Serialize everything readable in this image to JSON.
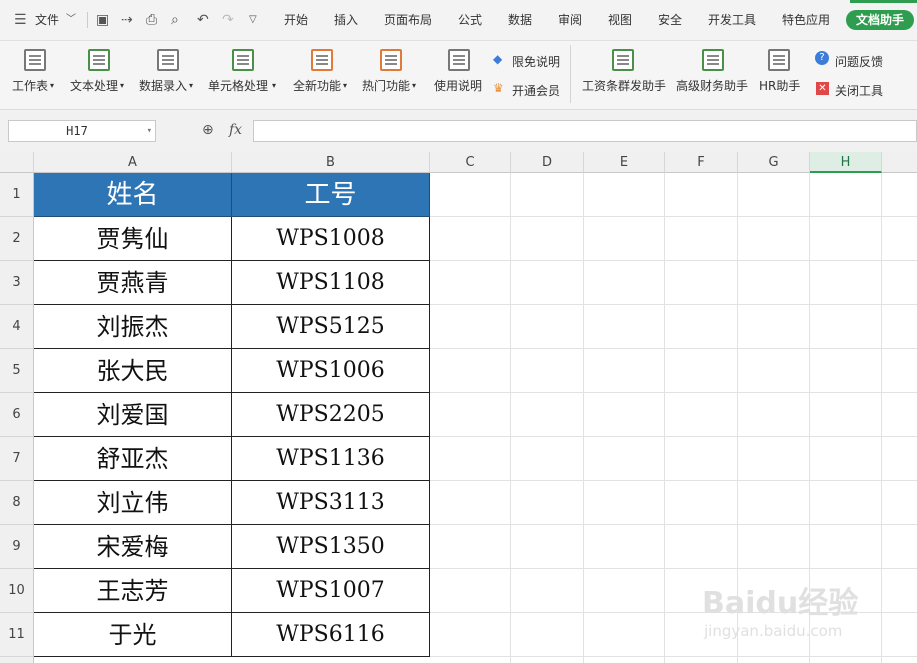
{
  "menubar": {
    "file_label": "文件",
    "tabs": [
      "开始",
      "插入",
      "页面布局",
      "公式",
      "数据",
      "审阅",
      "视图",
      "安全",
      "开发工具",
      "特色应用"
    ],
    "assistant_label": "文档助手"
  },
  "ribbon": {
    "buttons": [
      {
        "label": "工作表",
        "icon": "worksheet-icon"
      },
      {
        "label": "文本处理",
        "icon": "text-process-icon"
      },
      {
        "label": "数据录入",
        "icon": "data-entry-icon"
      },
      {
        "label": "单元格处理",
        "icon": "cell-process-icon"
      },
      {
        "label": "全新功能",
        "icon": "new-feature-icon"
      },
      {
        "label": "热门功能",
        "icon": "hot-feature-icon"
      },
      {
        "label": "使用说明",
        "icon": "manual-icon"
      }
    ],
    "small": {
      "free_label": "限免说明",
      "vip_label": "开通会员"
    },
    "helpers": [
      {
        "label": "工资条群发助手",
        "icon": "payslip-icon"
      },
      {
        "label": "高级财务助手",
        "icon": "finance-icon"
      },
      {
        "label": "HR助手",
        "icon": "hr-icon"
      }
    ],
    "feedback_label": "问题反馈",
    "close_label": "关闭工具"
  },
  "formula_bar": {
    "name_box": "H17",
    "fx_label": "fx",
    "formula": ""
  },
  "sheet": {
    "columns": [
      "A",
      "B",
      "C",
      "D",
      "E",
      "F",
      "G",
      "H"
    ],
    "active_column": "H",
    "rows": [
      "1",
      "2",
      "3",
      "4",
      "5",
      "6",
      "7",
      "8",
      "9",
      "10",
      "11"
    ],
    "headers": [
      "姓名",
      "工号"
    ],
    "records": [
      {
        "name": "贾隽仙",
        "id": "WPS1008"
      },
      {
        "name": "贾燕青",
        "id": "WPS1108"
      },
      {
        "name": "刘振杰",
        "id": "WPS5125"
      },
      {
        "name": "张大民",
        "id": "WPS1006"
      },
      {
        "name": "刘爱国",
        "id": "WPS2205"
      },
      {
        "name": "舒亚杰",
        "id": "WPS1136"
      },
      {
        "name": "刘立伟",
        "id": "WPS3113"
      },
      {
        "name": "宋爱梅",
        "id": "WPS1350"
      },
      {
        "name": "王志芳",
        "id": "WPS1007"
      },
      {
        "name": "于光",
        "id": "WPS6116"
      }
    ],
    "header_fill": "#2e75b6"
  },
  "watermark": {
    "brand": "Baidu经验",
    "url": "jingyan.baidu.com"
  }
}
